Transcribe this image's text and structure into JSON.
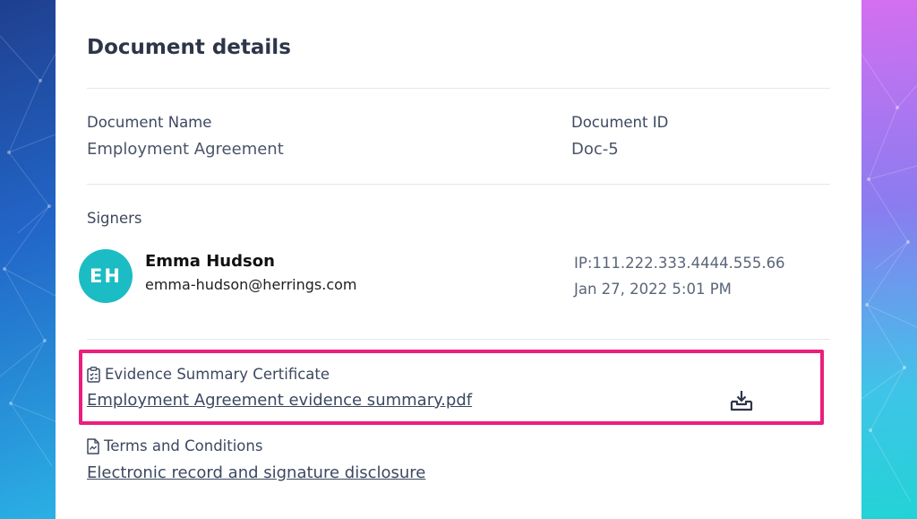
{
  "page_title": "Document details",
  "document": {
    "name_label": "Document Name",
    "name_value": "Employment Agreement",
    "id_label": "Document ID",
    "id_value": "Doc-5"
  },
  "signers": {
    "label": "Signers",
    "list": [
      {
        "initials": "EH",
        "name": "Emma Hudson",
        "email": "emma-hudson@herrings.com",
        "ip": "IP:111.222.333.4444.555.66",
        "timestamp": "Jan 27, 2022 5:01 PM",
        "avatar_color": "#1cbcc4"
      }
    ]
  },
  "evidence": {
    "heading": "Evidence Summary Certificate",
    "icon": "clipboard-check-icon",
    "file_link": "Employment Agreement evidence summary.pdf",
    "action_icon": "download-icon",
    "highlight_color": "#ea1f7d"
  },
  "terms": {
    "heading": "Terms and Conditions",
    "icon": "document-icon",
    "file_link": "Electronic record and signature disclosure"
  }
}
